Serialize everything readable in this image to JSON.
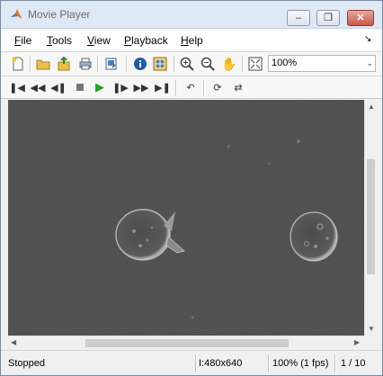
{
  "window": {
    "title": "Movie Player"
  },
  "menu": [
    {
      "label": "File",
      "key": "F",
      "rest": "ile"
    },
    {
      "label": "Tools",
      "key": "T",
      "rest": "ools"
    },
    {
      "label": "View",
      "key": "V",
      "rest": "iew"
    },
    {
      "label": "Playback",
      "key": "P",
      "rest": "layback"
    },
    {
      "label": "Help",
      "key": "H",
      "rest": "elp"
    }
  ],
  "toolbar": {
    "zoom_value": "100%",
    "icons": [
      "new-icon",
      "open-folder-icon",
      "export-icon",
      "print-icon",
      "export-to-imtool-icon",
      "info-icon",
      "pixel-region-icon",
      "zoom-in-icon",
      "zoom-out-icon",
      "pan-hand-icon",
      "fit-to-window-icon"
    ]
  },
  "playback_toolbar": {
    "icons": [
      "go-to-first-icon",
      "rewind-icon",
      "step-back-icon",
      "stop-icon",
      "play-icon",
      "step-forward-icon",
      "fast-forward-icon",
      "go-to-last-icon",
      "jump-to-icon",
      "repeat-icon",
      "forward-backward-icon"
    ]
  },
  "status": {
    "state": "Stopped",
    "format": "I:480x640",
    "zoom_rate": "100% (1 fps)",
    "frame": "1 / 10"
  },
  "scroll": {
    "vertical_fraction": 0.49,
    "horizontal_fraction": 0.57
  }
}
